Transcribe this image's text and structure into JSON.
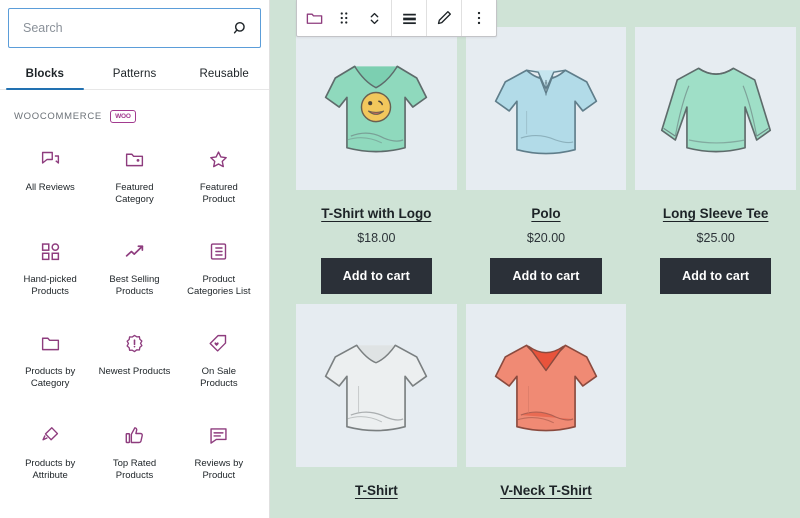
{
  "inserter": {
    "search": {
      "value": "",
      "placeholder": "Search",
      "icon": "search-icon"
    },
    "tabs": [
      {
        "label": "Blocks",
        "active": true
      },
      {
        "label": "Patterns",
        "active": false
      },
      {
        "label": "Reusable",
        "active": false
      }
    ],
    "category": {
      "title": "WOOCOMMERCE",
      "badge": "WOO",
      "badge_color": "#a23b8f"
    },
    "blocks": [
      {
        "label": "All Reviews",
        "icon": "reviews-comments-icon"
      },
      {
        "label": "Featured Category",
        "icon": "folder-dot-icon"
      },
      {
        "label": "Featured Product",
        "icon": "star-icon"
      },
      {
        "label": "Hand-picked Products",
        "icon": "grid-shapes-icon"
      },
      {
        "label": "Best Selling Products",
        "icon": "trending-up-icon"
      },
      {
        "label": "Product Categories List",
        "icon": "list-box-icon"
      },
      {
        "label": "Products by Category",
        "icon": "folder-icon"
      },
      {
        "label": "Newest Products",
        "icon": "new-badge-icon"
      },
      {
        "label": "On Sale Products",
        "icon": "sale-tag-icon"
      },
      {
        "label": "Products by Attribute",
        "icon": "attribute-tilt-icon"
      },
      {
        "label": "Top Rated Products",
        "icon": "thumbs-up-icon"
      },
      {
        "label": "Reviews by Product",
        "icon": "comment-box-icon"
      }
    ]
  },
  "toolbar": {
    "buttons": [
      {
        "name": "block-type-folder",
        "icon": "folder-icon"
      },
      {
        "name": "drag-handle",
        "icon": "drag-dots-icon"
      },
      {
        "name": "move-updown",
        "icon": "chevron-updown-icon"
      },
      {
        "name": "align",
        "icon": "align-icon"
      },
      {
        "name": "edit",
        "icon": "pencil-icon"
      },
      {
        "name": "more-options",
        "icon": "vertical-dots-icon"
      }
    ]
  },
  "canvas": {
    "background_color": "#cfe3d6",
    "image_background": "#e6ecf1",
    "button_color": "#2b3038",
    "add_to_cart_label": "Add to cart",
    "products": [
      {
        "title": "T-Shirt with Logo",
        "price": "$18.00",
        "image": "green-tshirt-logo"
      },
      {
        "title": "Polo",
        "price": "$20.00",
        "image": "blue-polo-shirt"
      },
      {
        "title": "Long Sleeve Tee",
        "price": "$25.00",
        "image": "mint-long-sleeve"
      },
      {
        "title": "T-Shirt",
        "price": "",
        "image": "gray-tshirt"
      },
      {
        "title": "V-Neck T-Shirt",
        "price": "",
        "image": "coral-vneck-tshirt"
      }
    ]
  }
}
